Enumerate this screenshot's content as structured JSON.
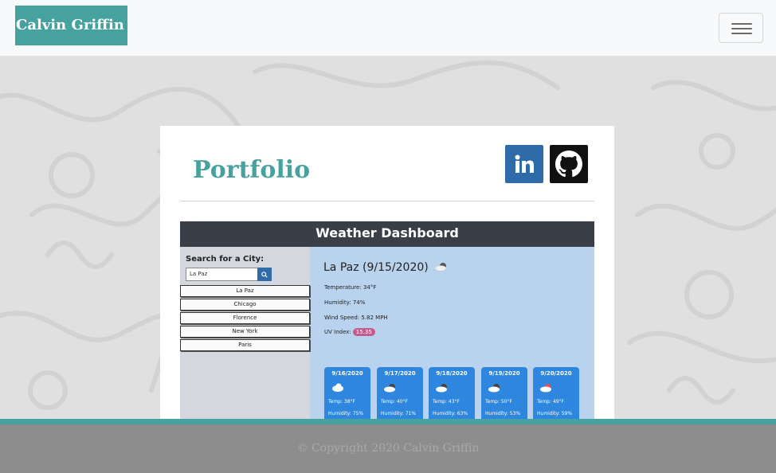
{
  "navbar": {
    "brand": "Calvin Griffin"
  },
  "card": {
    "title": "Portfolio",
    "social": [
      "linkedin-icon",
      "github-icon"
    ]
  },
  "project": {
    "app_title": "Weather Dashboard",
    "search_label": "Search for a City:",
    "search_value": "La Paz",
    "cities": [
      "La Paz",
      "Chicago",
      "Florence",
      "New York",
      "Paris"
    ],
    "current": {
      "heading": "La Paz (9/15/2020)",
      "temperature": "Temperature: 34°F",
      "humidity": "Humidity: 74%",
      "wind": "Wind Speed: 5.82 MPH",
      "uv_label": "UV Index:",
      "uv_value": "15.35"
    },
    "forecast": [
      {
        "date": "9/16/2020",
        "temp": "Temp: 38°F",
        "humidity": "Humidity: 75%"
      },
      {
        "date": "9/17/2020",
        "temp": "Temp: 40°F",
        "humidity": "Humidity: 71%"
      },
      {
        "date": "9/18/2020",
        "temp": "Temp: 43°F",
        "humidity": "Humidity: 63%"
      },
      {
        "date": "9/19/2020",
        "temp": "Temp: 50°F",
        "humidity": "Humidity: 53%"
      },
      {
        "date": "9/20/2020",
        "temp": "Temp: 49°F",
        "humidity": "Humidity: 59%"
      }
    ]
  },
  "footer": {
    "copyright": "© Copyright 2020 Calvin Griffin"
  }
}
